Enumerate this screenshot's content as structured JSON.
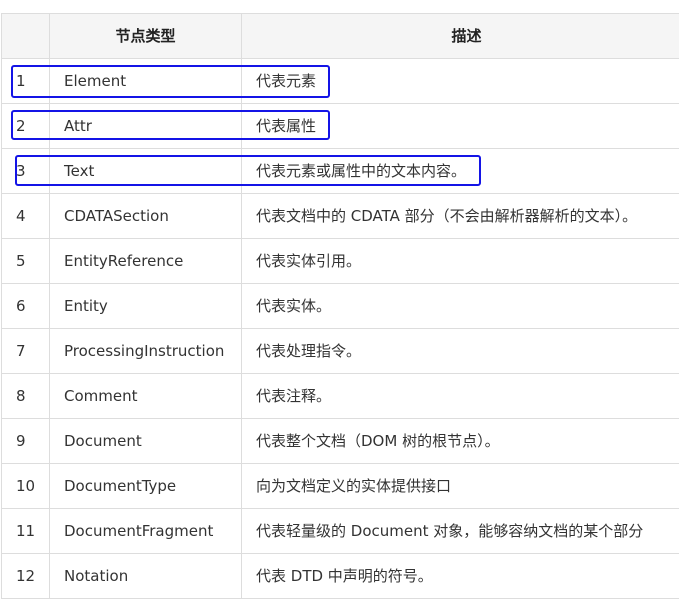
{
  "header": {
    "type_label": "节点类型",
    "desc_label": "描述"
  },
  "rows": [
    {
      "num": "1",
      "type": "Element",
      "desc": "代表元素"
    },
    {
      "num": "2",
      "type": "Attr",
      "desc": "代表属性"
    },
    {
      "num": "3",
      "type": "Text",
      "desc": "代表元素或属性中的文本内容。"
    },
    {
      "num": "4",
      "type": "CDATASection",
      "desc": "代表文档中的 CDATA 部分（不会由解析器解析的文本）。"
    },
    {
      "num": "5",
      "type": "EntityReference",
      "desc": "代表实体引用。"
    },
    {
      "num": "6",
      "type": "Entity",
      "desc": "代表实体。"
    },
    {
      "num": "7",
      "type": "ProcessingInstruction",
      "desc": "代表处理指令。"
    },
    {
      "num": "8",
      "type": "Comment",
      "desc": "代表注释。"
    },
    {
      "num": "9",
      "type": "Document",
      "desc": "代表整个文档（DOM 树的根节点）。"
    },
    {
      "num": "10",
      "type": "DocumentType",
      "desc": "向为文档定义的实体提供接口"
    },
    {
      "num": "11",
      "type": "DocumentFragment",
      "desc": "代表轻量级的 Document 对象，能够容纳文档的某个部分"
    },
    {
      "num": "12",
      "type": "Notation",
      "desc": "代表 DTD 中声明的符号。"
    }
  ],
  "highlight_color": "#1414e6"
}
